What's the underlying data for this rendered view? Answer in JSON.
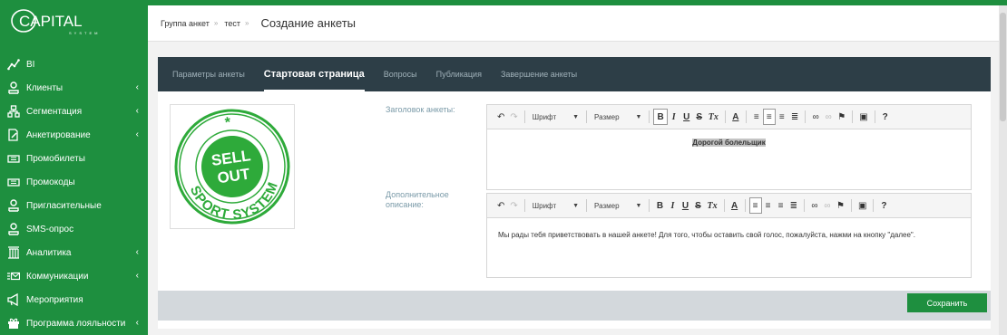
{
  "logo": {
    "text": "CAPITAL",
    "subtext": "SYSTEM"
  },
  "sidebar": {
    "items": [
      {
        "label": "BI",
        "icon": "chart-line-icon",
        "chevron": false
      },
      {
        "label": "Клиенты",
        "icon": "user-icon",
        "chevron": true
      },
      {
        "label": "Сегментация",
        "icon": "hierarchy-icon",
        "chevron": true
      },
      {
        "label": "Анкетирование",
        "icon": "form-edit-icon",
        "chevron": true
      },
      {
        "label": "Промобилеты",
        "icon": "ticket-icon",
        "chevron": false
      },
      {
        "label": "Промокоды",
        "icon": "ticket-icon",
        "chevron": false
      },
      {
        "label": "Пригласительные",
        "icon": "user-icon",
        "chevron": false
      },
      {
        "label": "SMS-опрос",
        "icon": "user-icon",
        "chevron": false
      },
      {
        "label": "Аналитика",
        "icon": "building-icon",
        "chevron": true
      },
      {
        "label": "Коммуникации",
        "icon": "list-envelope-icon",
        "chevron": true
      },
      {
        "label": "Мероприятия",
        "icon": "megaphone-icon",
        "chevron": false
      },
      {
        "label": "Программа лояльности",
        "icon": "gift-icon",
        "chevron": true
      }
    ],
    "chevron_glyph": "‹"
  },
  "breadcrumb": {
    "item1": "Группа анкет",
    "item2": "тест",
    "sep": "»"
  },
  "page_title": "Создание анкеты",
  "tabs": [
    {
      "label": "Параметры анкеты",
      "active": false
    },
    {
      "label": "Стартовая страница",
      "active": true
    },
    {
      "label": "Вопросы",
      "active": false
    },
    {
      "label": "Публикация",
      "active": false
    },
    {
      "label": "Завершение анкеты",
      "active": false
    }
  ],
  "image": {
    "line1": "SELL",
    "line2": "OUT",
    "ring": "SPORT SYSTEM"
  },
  "form": {
    "title_label": "Заголовок анкеты:",
    "desc_label_line1": "Дополнительное",
    "desc_label_line2": "описание:",
    "title_value": "Дорогой болельщик",
    "desc_value": "Мы рады тебя приветствовать в нашей анкете! Для того, чтобы оставить свой голос, пожалуйста, нажми на кнопку \"далее\"."
  },
  "toolbar": {
    "font_label": "Шрифт",
    "size_label": "Размер",
    "bold": "B",
    "italic": "I",
    "underline": "U",
    "strike": "S",
    "clear": "Tx",
    "color": "A",
    "help": "?"
  },
  "save_label": "Сохранить",
  "colors": {
    "brand_green": "#1e8f3f",
    "tabs_bg": "#2d3e47",
    "footer_bg": "#d3d8dc"
  }
}
